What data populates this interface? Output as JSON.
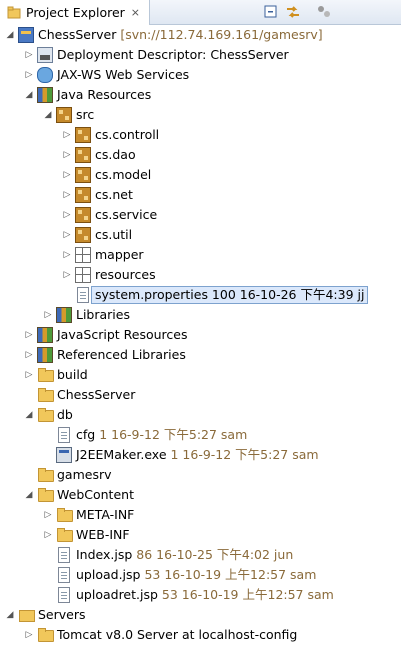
{
  "view": {
    "tab_label": "Project Explorer",
    "tab_close": "⨯",
    "toolbar": [
      "collapse-all-icon",
      "link-with-editor-icon",
      "view-menu-icon"
    ]
  },
  "tree": [
    {
      "depth": 0,
      "expanded": true,
      "icon": "project-icon",
      "label": "ChessServer",
      "decoration": "[svn://112.74.169.161/gamesrv]"
    },
    {
      "depth": 1,
      "expanded": false,
      "icon": "deployment-descriptor-icon",
      "label": "Deployment Descriptor: ChessServer",
      "decoration": ""
    },
    {
      "depth": 1,
      "expanded": false,
      "icon": "web-services-icon",
      "label": "JAX-WS Web Services",
      "decoration": ""
    },
    {
      "depth": 1,
      "expanded": true,
      "icon": "java-resources-icon",
      "label": "Java Resources",
      "decoration": ""
    },
    {
      "depth": 2,
      "expanded": true,
      "icon": "source-folder-icon",
      "label": "src",
      "decoration": ""
    },
    {
      "depth": 3,
      "expanded": false,
      "icon": "package-icon",
      "label": "cs.controll",
      "decoration": ""
    },
    {
      "depth": 3,
      "expanded": false,
      "icon": "package-icon",
      "label": "cs.dao",
      "decoration": ""
    },
    {
      "depth": 3,
      "expanded": false,
      "icon": "package-icon",
      "label": "cs.model",
      "decoration": ""
    },
    {
      "depth": 3,
      "expanded": false,
      "icon": "package-icon",
      "label": "cs.net",
      "decoration": ""
    },
    {
      "depth": 3,
      "expanded": false,
      "icon": "package-icon",
      "label": "cs.service",
      "decoration": ""
    },
    {
      "depth": 3,
      "expanded": false,
      "icon": "package-icon",
      "label": "cs.util",
      "decoration": ""
    },
    {
      "depth": 3,
      "expanded": false,
      "icon": "empty-package-icon",
      "label": "mapper",
      "decoration": ""
    },
    {
      "depth": 3,
      "expanded": false,
      "icon": "empty-package-icon",
      "label": "resources",
      "decoration": ""
    },
    {
      "depth": 3,
      "expanded": null,
      "icon": "properties-file-icon",
      "label": "system.properties",
      "decoration": "100  16-10-26 下午4:39  jj",
      "selected": true
    },
    {
      "depth": 2,
      "expanded": false,
      "icon": "libraries-icon",
      "label": "Libraries",
      "decoration": ""
    },
    {
      "depth": 1,
      "expanded": false,
      "icon": "javascript-resources-icon",
      "label": "JavaScript Resources",
      "decoration": ""
    },
    {
      "depth": 1,
      "expanded": false,
      "icon": "referenced-libraries-icon",
      "label": "Referenced Libraries",
      "decoration": ""
    },
    {
      "depth": 1,
      "expanded": false,
      "icon": "folder-icon",
      "label": "build",
      "decoration": ""
    },
    {
      "depth": 1,
      "expanded": null,
      "icon": "folder-icon",
      "label": "ChessServer",
      "decoration": ""
    },
    {
      "depth": 1,
      "expanded": true,
      "icon": "folder-icon",
      "label": "db",
      "decoration": ""
    },
    {
      "depth": 2,
      "expanded": null,
      "icon": "file-icon",
      "label": "cfg",
      "decoration": "1  16-9-12 下午5:27  sam"
    },
    {
      "depth": 2,
      "expanded": null,
      "icon": "exe-file-icon",
      "label": "J2EEMaker.exe",
      "decoration": "1  16-9-12 下午5:27  sam"
    },
    {
      "depth": 1,
      "expanded": null,
      "icon": "folder-icon",
      "label": "gamesrv",
      "decoration": ""
    },
    {
      "depth": 1,
      "expanded": true,
      "icon": "folder-icon",
      "label": "WebContent",
      "decoration": ""
    },
    {
      "depth": 2,
      "expanded": false,
      "icon": "folder-icon",
      "label": "META-INF",
      "decoration": ""
    },
    {
      "depth": 2,
      "expanded": false,
      "icon": "folder-icon",
      "label": "WEB-INF",
      "decoration": ""
    },
    {
      "depth": 2,
      "expanded": null,
      "icon": "jsp-file-icon",
      "label": "Index.jsp",
      "decoration": "86  16-10-25 下午4:02  jun"
    },
    {
      "depth": 2,
      "expanded": null,
      "icon": "jsp-file-icon",
      "label": "upload.jsp",
      "decoration": "53  16-10-19 上午12:57  sam"
    },
    {
      "depth": 2,
      "expanded": null,
      "icon": "jsp-file-icon",
      "label": "uploadret.jsp",
      "decoration": "53  16-10-19 上午12:57  sam"
    },
    {
      "depth": 0,
      "expanded": true,
      "icon": "servers-folder-icon",
      "label": "Servers",
      "decoration": ""
    },
    {
      "depth": 1,
      "expanded": false,
      "icon": "folder-icon",
      "label": "Tomcat v8.0 Server at localhost-config",
      "decoration": ""
    }
  ]
}
